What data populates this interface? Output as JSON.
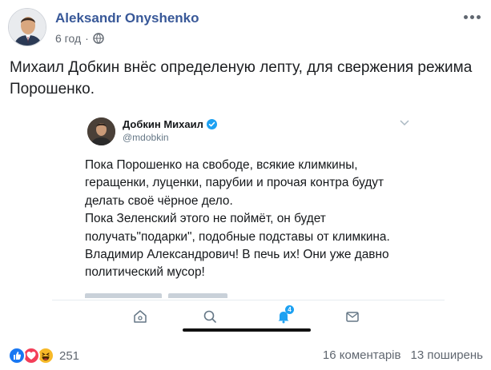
{
  "post": {
    "author": "Aleksandr Onyshenko",
    "time": "6 год",
    "dot": "·",
    "text": "Михаил Добкин внёс определеную лепту, для свержения режима Порошенко.",
    "privacy_icon": "globe-icon",
    "menu_icon": "more-dots-icon"
  },
  "tweet": {
    "name": "Добкин Михаил",
    "handle": "@mdobkin",
    "verified_icon": "verified-badge-icon",
    "lines": [
      "Пока Порошенко на свободе, всякие климкины,",
      "геращенки, луценки, парубии и прочая контра будут",
      "делать своё чёрное дело.",
      "Пока Зеленский этого не поймёт, он будет",
      "получать\"подарки\", подобные подставы от климкина.",
      "Владимир Александрович! В печь их! Они уже давно",
      "политический мусор!"
    ],
    "tabs": [
      "home-icon",
      "search-icon",
      "notifications-icon",
      "messages-icon"
    ],
    "notification_count": "4",
    "accent": "#1da1f2"
  },
  "footer": {
    "reactions": [
      "like-icon",
      "love-icon",
      "haha-icon"
    ],
    "reaction_count": "251",
    "comments": "16 коментарів",
    "shares": "13 поширень"
  },
  "colors": {
    "author_link": "#385898",
    "secondary_text": "#606770",
    "like_blue": "#1877f2",
    "love_red": "#f33e58",
    "haha_yellow": "#f7b928"
  }
}
